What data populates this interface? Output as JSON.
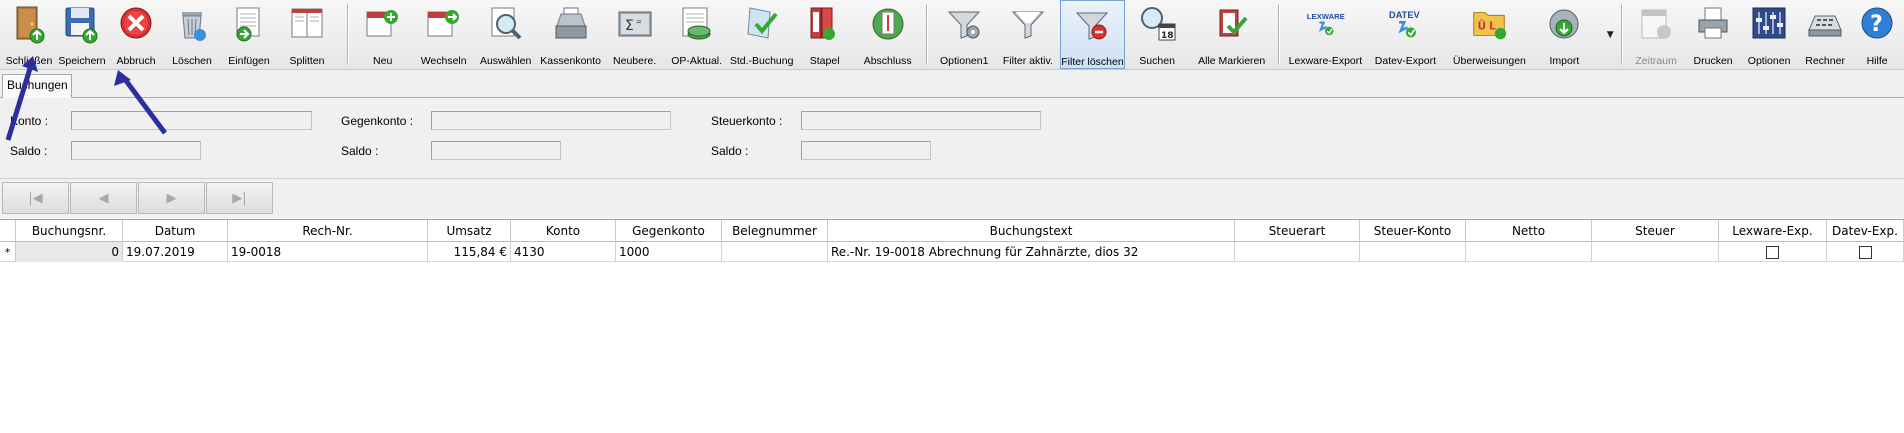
{
  "toolbar": {
    "group1": [
      {
        "id": "schliessen",
        "label": "Schließen",
        "icon": "door-exit-icon",
        "ul": "S"
      },
      {
        "id": "speichern",
        "label": "Speichern",
        "icon": "floppy-save-icon",
        "ul": "S"
      },
      {
        "id": "abbruch",
        "label": "Abbruch",
        "icon": "red-x-cancel-icon",
        "ul": "A"
      },
      {
        "id": "loeschen",
        "label": "Löschen",
        "icon": "recycle-bin-icon",
        "ul": "L"
      },
      {
        "id": "einfuegen",
        "label": "Einfügen",
        "icon": "insert-doc-icon",
        "ul": "E"
      },
      {
        "id": "splitten",
        "label": "Splitten",
        "icon": "split-doc-icon",
        "ul": "S"
      }
    ],
    "group2": [
      {
        "id": "neu",
        "label": "Neu",
        "icon": "calendar-new-icon"
      },
      {
        "id": "wechseln",
        "label": "Wechseln",
        "icon": "calendar-switch-icon"
      },
      {
        "id": "auswaehlen",
        "label": "Auswählen",
        "icon": "magnifier-select-icon"
      },
      {
        "id": "kassenkonto",
        "label": "Kassenkonto",
        "icon": "cash-register-icon"
      },
      {
        "id": "neubere",
        "label": "Neubere.",
        "icon": "sum-calc-icon"
      },
      {
        "id": "opaktual",
        "label": "OP-Aktual.",
        "icon": "money-refresh-icon"
      },
      {
        "id": "stdbuchung",
        "label": "Std.-Buchung",
        "icon": "doc-check-icon"
      },
      {
        "id": "stapel",
        "label": "Stapel",
        "icon": "stack-books-icon"
      },
      {
        "id": "abschluss",
        "label": "Abschluss",
        "icon": "globe-doc-icon"
      }
    ],
    "group3": [
      {
        "id": "optionen1",
        "label": "Optionen1",
        "icon": "funnel-options-icon"
      },
      {
        "id": "filteraktiv",
        "label": "Filter aktiv.",
        "icon": "funnel-active-icon"
      },
      {
        "id": "filterloeschen",
        "label": "Filter löschen",
        "icon": "funnel-delete-icon",
        "active": true
      },
      {
        "id": "suchen",
        "label": "Suchen",
        "icon": "search-calendar-icon"
      },
      {
        "id": "allemarkieren",
        "label": "Alle Markieren",
        "icon": "check-mark-all-icon"
      }
    ],
    "group4": [
      {
        "id": "lexware",
        "label": "Lexware-Export",
        "icon": "lexware-export-icon",
        "brand": "LEXWARE"
      },
      {
        "id": "datev",
        "label": "Datev-Export",
        "icon": "datev-export-icon",
        "brand": "DATEV"
      },
      {
        "id": "ueberweisungen",
        "label": "Überweisungen",
        "icon": "transfer-folder-icon"
      },
      {
        "id": "import",
        "label": "Import",
        "icon": "import-globe-icon"
      }
    ],
    "group5": [
      {
        "id": "zeitraum",
        "label": "Zeitraum",
        "icon": "calendar-range-icon",
        "disabled": true
      },
      {
        "id": "drucken",
        "label": "Drucken",
        "icon": "printer-icon",
        "ul": "D"
      },
      {
        "id": "optionen",
        "label": "Optionen",
        "icon": "sliders-options-icon",
        "ul": "O"
      },
      {
        "id": "rechner",
        "label": "Rechner",
        "icon": "calculator-icon"
      },
      {
        "id": "hilfe",
        "label": "Hilfe",
        "icon": "help-question-icon",
        "ul": "H"
      }
    ]
  },
  "tab": {
    "label": "Buchungen"
  },
  "filters": {
    "konto_label": "Konto :",
    "gegenkonto_label": "Gegenkonto :",
    "steuerkonto_label": "Steuerkonto :",
    "saldo_label": "Saldo :",
    "konto_value": "",
    "gegenkonto_value": "",
    "steuerkonto_value": "",
    "saldo1_value": "",
    "saldo2_value": "",
    "saldo3_value": ""
  },
  "nav": {
    "first": "|◀",
    "prev": "◀",
    "next": "▶",
    "last": "▶|"
  },
  "grid": {
    "columns": [
      "Buchungsnr.",
      "Datum",
      "Rech-Nr.",
      "Umsatz",
      "Konto",
      "Gegenkonto",
      "Belegnummer",
      "Buchungstext",
      "Steuerart",
      "Steuer-Konto",
      "Netto",
      "Steuer",
      "Lexware-Exp.",
      "Datev-Exp."
    ],
    "rows": [
      {
        "indicator": "*",
        "buchungsnr": "0",
        "datum": "19.07.2019",
        "rechnr": "19-0018",
        "umsatz": "115,84 €",
        "konto": "4130",
        "gegenkonto": "1000",
        "belegnummer": "",
        "buchungstext": "Re.-Nr. 19-0018 Abrechnung für Zahnärzte, dios 32",
        "steuerart": "",
        "steuerkonto": "",
        "netto": "",
        "steuer": "",
        "lexware_exp": false,
        "datev_exp": false
      }
    ]
  }
}
